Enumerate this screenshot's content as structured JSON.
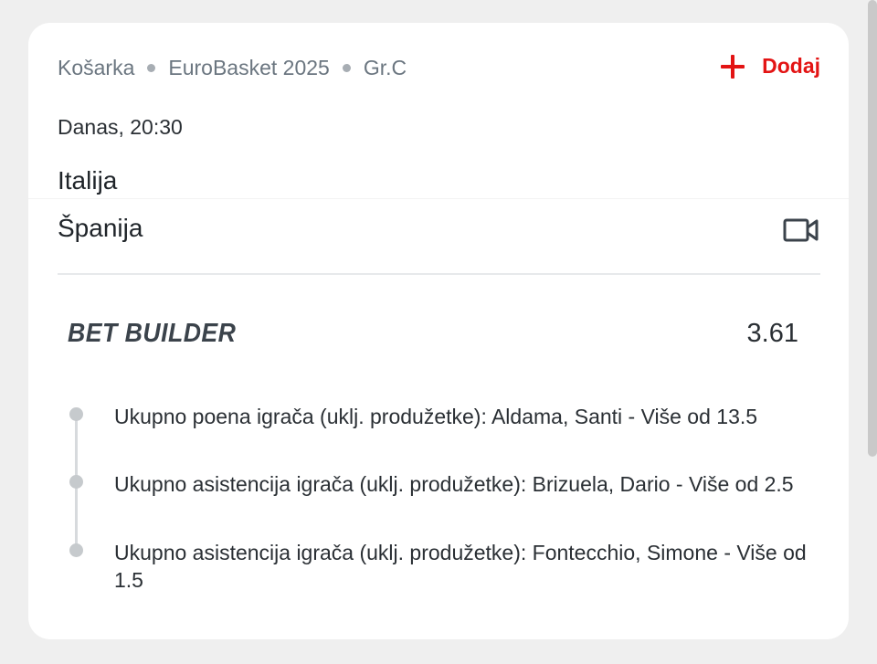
{
  "event": {
    "sport": "Košarka",
    "competition": "EuroBasket 2025",
    "group": "Gr.C",
    "add_label": "Dodaj",
    "datetime": "Danas, 20:30",
    "home_team": "Italija",
    "away_team": "Španija"
  },
  "bet_builder": {
    "title": "BET BUILDER",
    "odds": "3.61",
    "legs": [
      {
        "text": "Ukupno poena igrača (uklj. produžetke): Aldama, Santi - Više od 13.5"
      },
      {
        "text": "Ukupno asistencija igrača (uklj. produžetke): Brizuela, Dario - Više od 2.5"
      },
      {
        "text": "Ukupno asistencija igrača (uklj. produžetke): Fontecchio, Simone - Više od 1.5"
      }
    ]
  },
  "icons": {
    "add": "plus-icon",
    "video": "video-camera-icon"
  },
  "colors": {
    "accent": "#e31414",
    "background": "#efefef",
    "card": "#ffffff"
  }
}
